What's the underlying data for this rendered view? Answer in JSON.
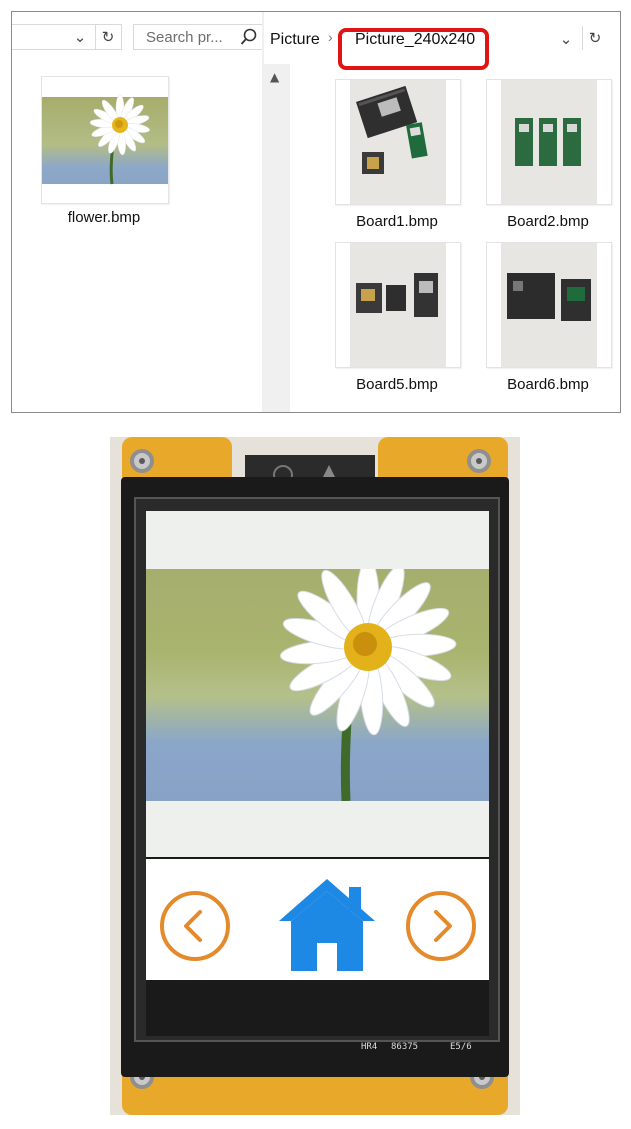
{
  "explorer": {
    "left_pane": {
      "search_placeholder": "Search pr...",
      "file": {
        "name": "flower.bmp"
      }
    },
    "right_pane": {
      "breadcrumb": [
        "Picture",
        "Picture_240x240"
      ],
      "files": [
        {
          "name": "Board1.bmp"
        },
        {
          "name": "Board2.bmp"
        },
        {
          "name": "Board5.bmp"
        },
        {
          "name": "Board6.bmp"
        }
      ]
    },
    "highlight_color": "#e01414"
  },
  "device": {
    "silkscreen": [
      "HR4",
      "86375",
      "E5/6"
    ],
    "buttons": {
      "prev": "chevron-left-icon",
      "home": "home-icon",
      "next": "chevron-right-icon"
    },
    "colors": {
      "nav_circle": "#e48a2b",
      "home": "#1e88e5",
      "pcb": "#e8a82a"
    }
  }
}
